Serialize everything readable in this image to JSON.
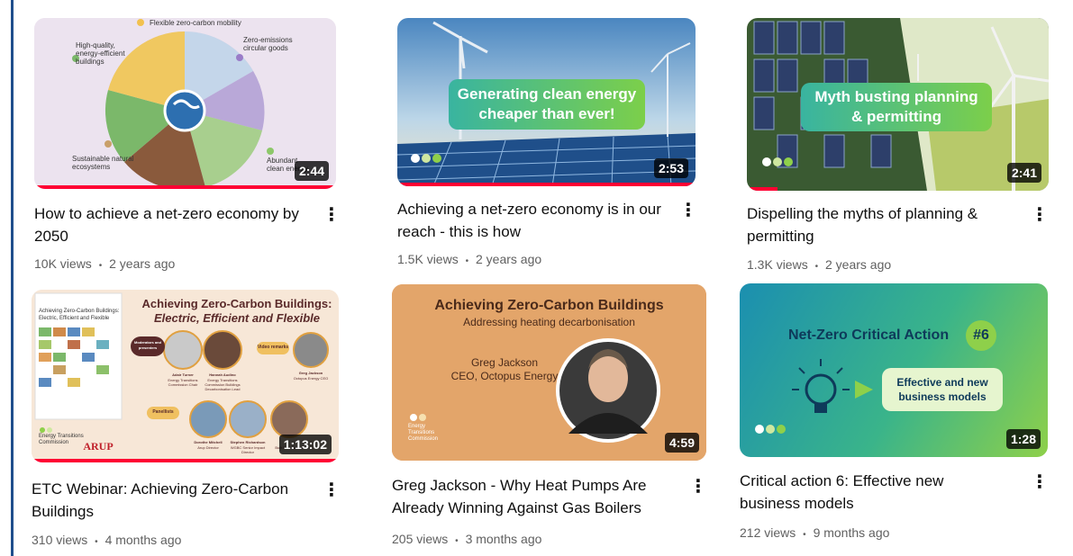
{
  "videos": [
    {
      "title": "How to achieve a net-zero economy by 2050",
      "views": "10K views",
      "age": "2 years ago",
      "duration": "2:44",
      "progress": 1.0,
      "thumb_text": {
        "top": "Flexible zero-carbon mobility",
        "left_top": "High-quality, energy-efficient buildings",
        "right_top": "Zero-emissions circular goods",
        "left_bottom": "Sustainable natural ecosystems",
        "right_bottom": "Abundant clean energy"
      }
    },
    {
      "title": "Achieving a net-zero economy is in our reach - this is how",
      "views": "1.5K views",
      "age": "2 years ago",
      "duration": "2:53",
      "progress": 1.0,
      "thumb_text": {
        "headline": "Generating clean energy cheaper than ever!"
      }
    },
    {
      "title": "Dispelling the myths of planning & permitting",
      "views": "1.3K views",
      "age": "2 years ago",
      "duration": "2:41",
      "progress": 0.1,
      "thumb_text": {
        "headline": "Myth busting planning & permitting"
      }
    },
    {
      "title": "ETC Webinar: Achieving Zero-Carbon Buildings",
      "views": "310 views",
      "age": "4 months ago",
      "duration": "1:13:02",
      "progress": 1.0,
      "thumb_text": {
        "headline": "Achieving Zero-Carbon Buildings:",
        "subhead": "Electric, Efficient and Flexible",
        "report": "Achieving Zero-Carbon Buildings: Electric, Efficient and Flexible",
        "moderators": "Moderators and presenters",
        "video_remarks": "Video remarks",
        "panellists": "Panellists",
        "org": "Energy Transitions Commission",
        "arup": "ARUP",
        "speakers": [
          {
            "name": "Adair Turner",
            "role": "Energy Transitions Commission Chair"
          },
          {
            "name": "Hannah Audino",
            "role": "Energy Transitions Commission Buildings Decarbonisation Lead"
          },
          {
            "name": "Greg Jackson",
            "role": "Octopus Energy CEO"
          },
          {
            "name": "Dorothe Mitchell",
            "role": "Arup Director"
          },
          {
            "name": "Stephen Richardson",
            "role": "WGBC Senior Impact Director"
          },
          {
            "name": "",
            "role": "Built Environment"
          }
        ]
      }
    },
    {
      "title": "Greg Jackson - Why Heat Pumps Are Already Winning Against Gas Boilers",
      "views": "205 views",
      "age": "3 months ago",
      "duration": "4:59",
      "progress": 0,
      "thumb_text": {
        "headline": "Achieving Zero-Carbon Buildings",
        "subhead": "Addressing heating decarbonisation",
        "speaker": "Greg Jackson",
        "role": "CEO, Octopus Energy",
        "org": "Energy Transitions Commission"
      }
    },
    {
      "title": "Critical action 6: Effective new business models",
      "views": "212 views",
      "age": "9 months ago",
      "duration": "1:28",
      "progress": 0,
      "thumb_text": {
        "headline": "Net-Zero Critical Action",
        "badge": "#6",
        "box": "Effective and new business models"
      }
    }
  ],
  "meta_separator": "•",
  "kebab_glyph": "⋮",
  "colors": {
    "progress": "#ff0033",
    "accent_green": "#6cc24a",
    "etc_maroon": "#5a2a2a",
    "card6_gradient": [
      "#1b8fb0",
      "#3ab48a",
      "#8ed04a"
    ]
  }
}
